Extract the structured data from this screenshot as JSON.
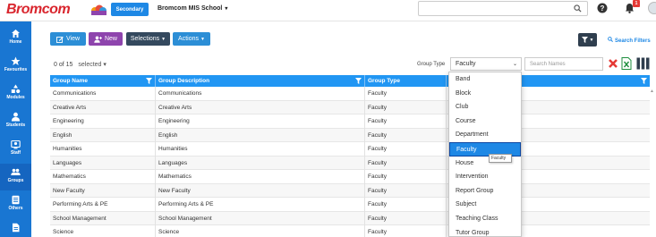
{
  "header": {
    "logo_text": "Bromcom",
    "badge": "Secondary",
    "school": "Bromcom MIS School",
    "notification_count": "1"
  },
  "sidebar": {
    "items": [
      {
        "label": "Home",
        "icon": "home-icon"
      },
      {
        "label": "Favourites",
        "icon": "star-icon"
      },
      {
        "label": "Modules",
        "icon": "modules-icon"
      },
      {
        "label": "Students",
        "icon": "person-icon"
      },
      {
        "label": "Staff",
        "icon": "staff-icon"
      },
      {
        "label": "Groups",
        "icon": "groups-icon"
      },
      {
        "label": "Others",
        "icon": "others-icon"
      },
      {
        "label": "",
        "icon": "document-icon"
      }
    ]
  },
  "toolbar": {
    "view_label": "View",
    "new_label": "New",
    "selections_label": "Selections",
    "actions_label": "Actions",
    "search_filters_label": "Search Filters"
  },
  "selection": {
    "count": "0 of 15",
    "selected_label": "selected"
  },
  "filters": {
    "group_type_label": "Group Type",
    "group_type_value": "Faculty",
    "search_placeholder": "Search Names"
  },
  "table": {
    "columns": [
      "Group Name",
      "Group Description",
      "Group Type",
      ""
    ],
    "rows": [
      [
        "Communications",
        "Communications",
        "Faculty"
      ],
      [
        "Creative Arts",
        "Creative Arts",
        "Faculty"
      ],
      [
        "Engineering",
        "Engineering",
        "Faculty"
      ],
      [
        "English",
        "English",
        "Faculty"
      ],
      [
        "Humanities",
        "Humanities",
        "Faculty"
      ],
      [
        "Languages",
        "Languages",
        "Faculty"
      ],
      [
        "Mathematics",
        "Mathematics",
        "Faculty"
      ],
      [
        "New Faculty",
        "New Faculty",
        "Faculty"
      ],
      [
        "Performing Arts & PE",
        "Performing Arts & PE",
        "Faculty"
      ],
      [
        "School Management",
        "School Management",
        "Faculty"
      ],
      [
        "Science",
        "Science",
        "Faculty"
      ]
    ]
  },
  "dropdown": {
    "options": [
      "Band",
      "Block",
      "Club",
      "Course",
      "Department",
      "Faculty",
      "House",
      "Intervention",
      "Report Group",
      "Subject",
      "Teaching Class",
      "Tutor Group"
    ],
    "selected": "Faculty",
    "tooltip": "Faculty"
  },
  "colors": {
    "sidebar": "#1976d2",
    "accent": "#2196f3",
    "brand_red": "#d9262e"
  }
}
